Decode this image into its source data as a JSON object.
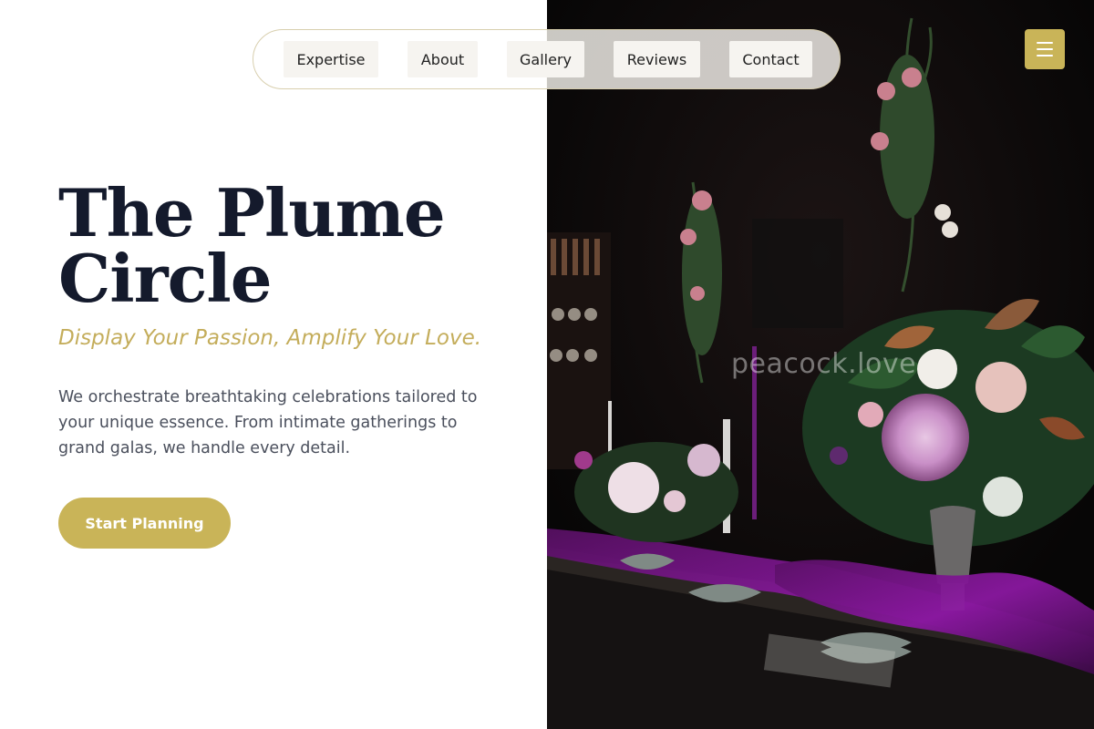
{
  "nav": {
    "items": [
      {
        "label": "Expertise"
      },
      {
        "label": "About"
      },
      {
        "label": "Gallery"
      },
      {
        "label": "Reviews"
      },
      {
        "label": "Contact"
      }
    ],
    "menu_icon": "hamburger-menu-icon"
  },
  "hero": {
    "title_line1": "The Plume",
    "title_line2": "Circle",
    "tagline": "Display Your Passion, Amplify Your Love.",
    "description": "We orchestrate breathtaking celebrations tailored to your unique essence. From intimate gatherings to grand galas, we handle every detail.",
    "cta_label": "Start Planning"
  },
  "image": {
    "watermark": "peacock.love"
  },
  "colors": {
    "accent_gold": "#c9b458",
    "title_navy": "#141a2c",
    "tagline_gold": "#c4ad5b",
    "body_text": "#4a4f5c"
  }
}
